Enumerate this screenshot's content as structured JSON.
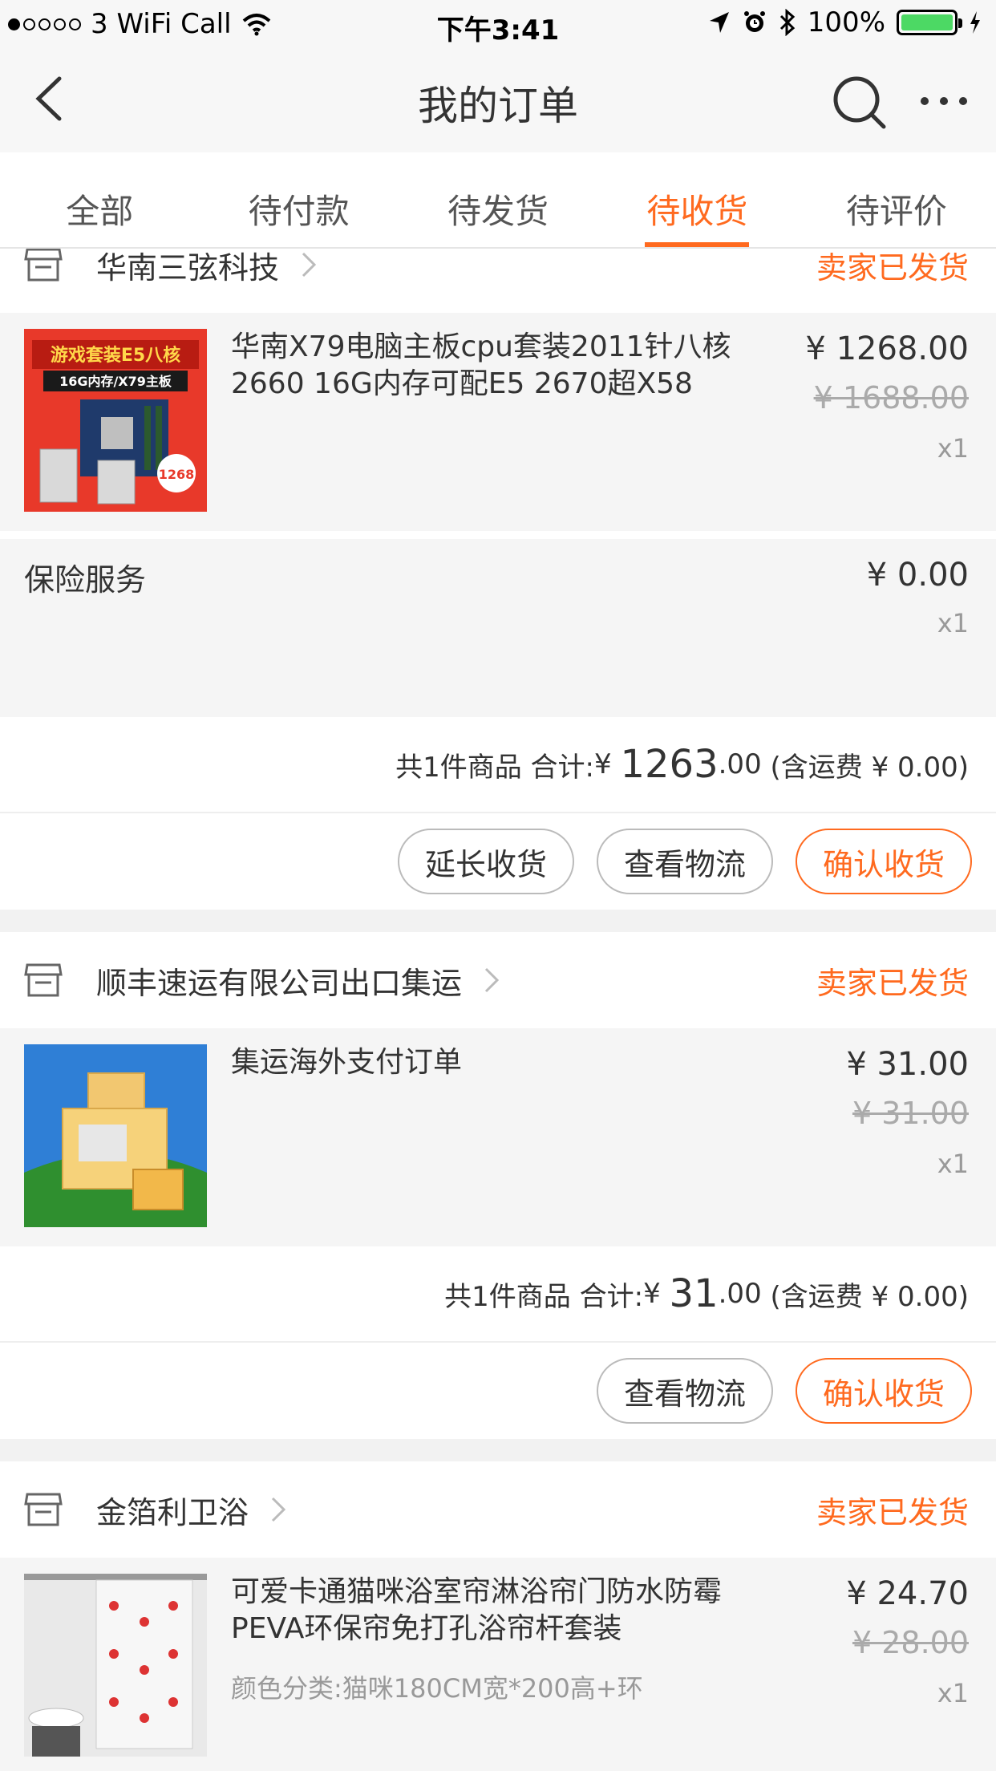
{
  "status_bar": {
    "carrier": "3 WiFi Call",
    "time": "下午3:41",
    "battery": "100%",
    "signal_bars": 1
  },
  "nav": {
    "title": "我的订单",
    "back_icon": "back-chevron-icon",
    "search_icon": "search-icon",
    "more_icon": "more-dots-icon"
  },
  "tabs": [
    {
      "label": "全部"
    },
    {
      "label": "待付款"
    },
    {
      "label": "待发货"
    },
    {
      "label": "待收货",
      "active": true
    },
    {
      "label": "待评价"
    }
  ],
  "accent_color": "#ff6a1f",
  "orders": [
    {
      "shop_name": "华南三弦科技",
      "status": "卖家已发货",
      "items": [
        {
          "title": "华南X79电脑主板cpu套装2011针八核2660 16G内存可配E5 2670超X58",
          "price": "¥ 1268.00",
          "original_price": "¥ 1688.00",
          "qty": "x1",
          "image": "motherboard-product-image",
          "image_text": {
            "banner": "游戏套装E5八核",
            "sub": "16G内存/X79主板",
            "tag": "1268"
          }
        }
      ],
      "insurance": {
        "label": "保险服务",
        "price": "¥ 0.00",
        "qty": "x1"
      },
      "summary": {
        "count": "共1件商品",
        "total_label": "合计:",
        "currency": "¥",
        "total_int": "1263",
        "total_dec": ".00",
        "shipping": "(含运费 ¥ 0.00)"
      },
      "actions": [
        "延长收货",
        "查看物流",
        "确认收货"
      ]
    },
    {
      "shop_name": "顺丰速运有限公司出口集运",
      "status": "卖家已发货",
      "items": [
        {
          "title": "集运海外支付订单",
          "price": "¥ 31.00",
          "original_price": "¥ 31.00",
          "qty": "x1",
          "image": "parcel-boxes-image"
        }
      ],
      "summary": {
        "count": "共1件商品",
        "total_label": "合计:",
        "currency": "¥",
        "total_int": "31",
        "total_dec": ".00",
        "shipping": "(含运费 ¥ 0.00)"
      },
      "actions": [
        "查看物流",
        "确认收货"
      ]
    },
    {
      "shop_name": "金箔利卫浴",
      "status": "卖家已发货",
      "items": [
        {
          "title": "可爱卡通猫咪浴室帘淋浴帘门防水防霉PEVA环保帘免打孔浴帘杆套装",
          "sku": "颜色分类:猫咪180CM宽*200高+环",
          "price": "¥ 24.70",
          "original_price": "¥ 28.00",
          "qty": "x1",
          "image": "shower-curtain-image"
        }
      ]
    }
  ]
}
